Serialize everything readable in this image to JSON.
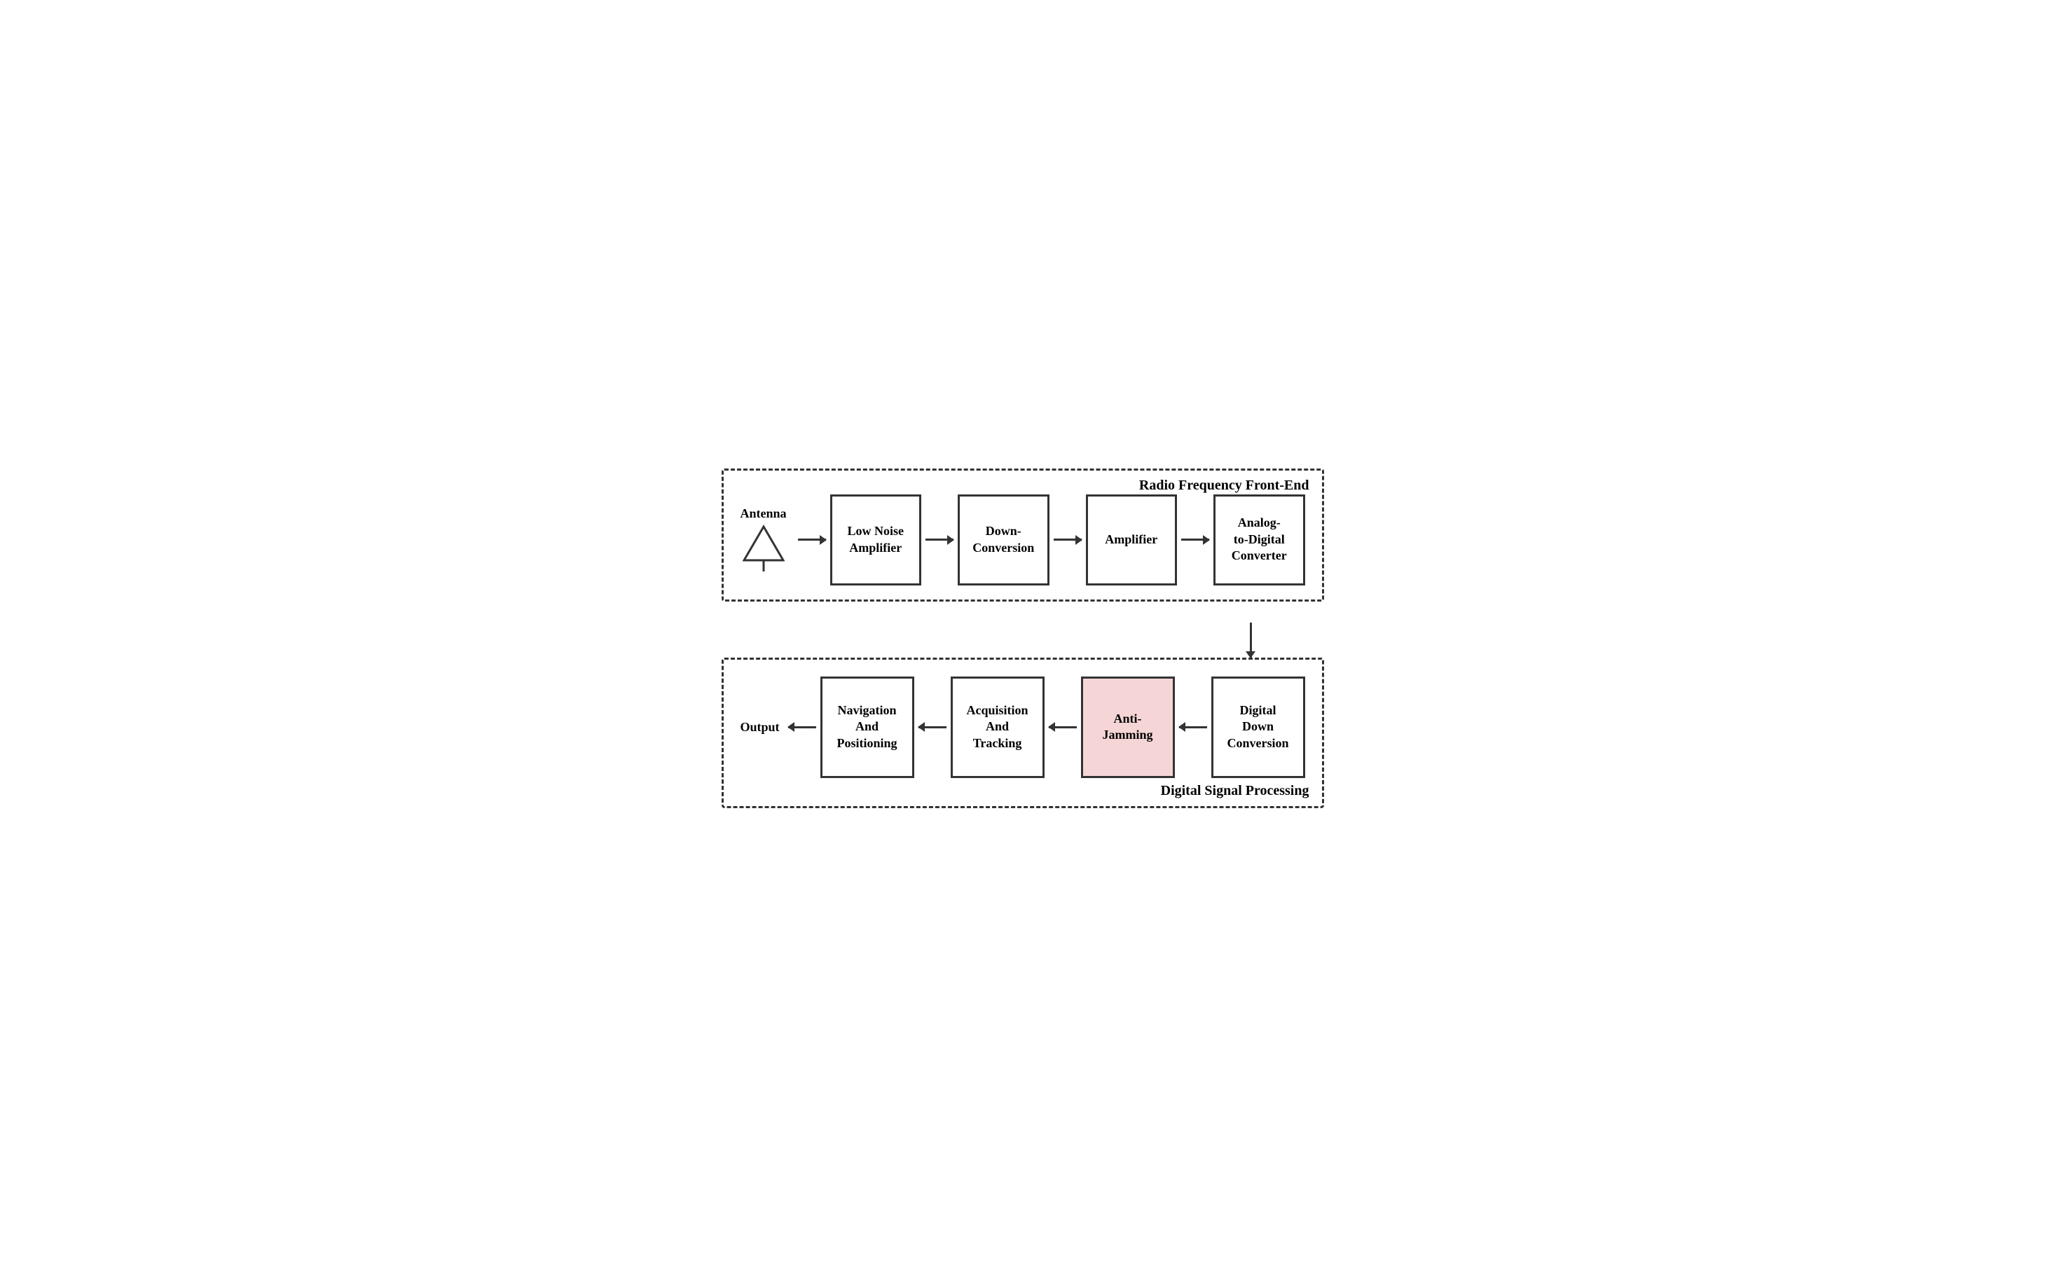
{
  "rf_section": {
    "label": "Radio Frequency Front-End",
    "antenna_label": "Antenna",
    "blocks": [
      {
        "id": "lna",
        "text": "Low Noise\nAmplifier"
      },
      {
        "id": "downconv",
        "text": "Down-\nConversion"
      },
      {
        "id": "amplifier",
        "text": "Amplifier"
      },
      {
        "id": "adc",
        "text": "Analog-\nto-Digital\nConverter"
      }
    ]
  },
  "dsp_section": {
    "label": "Digital Signal Processing",
    "output_label": "Output",
    "blocks": [
      {
        "id": "nav",
        "text": "Navigation\nAnd\nPositioning"
      },
      {
        "id": "acq",
        "text": "Acquisition\nAnd\nTracking"
      },
      {
        "id": "antijam",
        "text": "Anti-\nJamming"
      },
      {
        "id": "ddc",
        "text": "Digital\nDown\nConversion"
      }
    ]
  }
}
